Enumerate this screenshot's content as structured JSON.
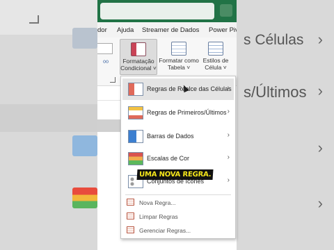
{
  "tabs": [
    "dor",
    "Ajuda",
    "Streamer de Dados",
    "Power Pivo"
  ],
  "ribbon": {
    "formatacao_condicional": [
      "Formatação",
      "Condicional ˅"
    ],
    "formatar_como_tabela": [
      "Formatar como",
      "Tabela ˅"
    ],
    "estilos_de_celula": [
      "Estilos de",
      "Célula ˅"
    ]
  },
  "menu": {
    "items": [
      {
        "label": "Regras de Realce das Células",
        "icon": "highlight-rules-icon"
      },
      {
        "label": "Regras de Primeiros/Últimos",
        "icon": "top-bottom-rules-icon"
      },
      {
        "label": "Barras de Dados",
        "icon": "data-bars-icon"
      },
      {
        "label": "Escalas de Cor",
        "icon": "color-scales-icon"
      },
      {
        "label": "Conjuntos de Ícones",
        "icon": "icon-sets-icon"
      }
    ],
    "actions": [
      {
        "label": "Nova Regra...",
        "icon": "new-rule-icon"
      },
      {
        "label": "Limpar Regras",
        "icon": "clear-rules-icon"
      },
      {
        "label": "Gerenciar Regras...",
        "icon": "manage-rules-icon"
      }
    ]
  },
  "caption": "UMA NOVA REGRA.",
  "background": {
    "right_top": "s Células",
    "right_mid": "s/Últimos"
  },
  "colors": {
    "excel_green": "#217346",
    "caption_text": "#f5e61a"
  }
}
